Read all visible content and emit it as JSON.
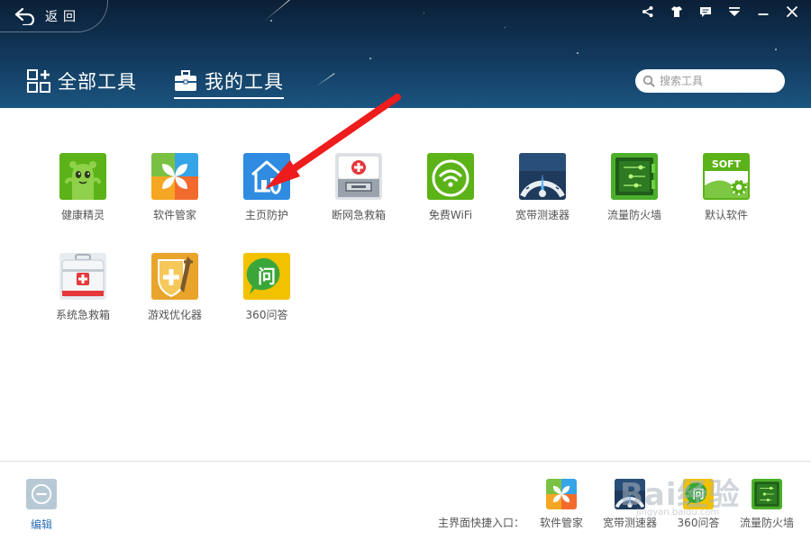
{
  "header": {
    "back_label": "返回",
    "tabs": [
      {
        "label": "全部工具",
        "active": false
      },
      {
        "label": "我的工具",
        "active": true
      }
    ],
    "search_placeholder": "搜索工具",
    "window_controls": [
      "share-icon",
      "skin-icon",
      "feedback-icon",
      "menu-icon",
      "minimize-icon",
      "close-icon"
    ]
  },
  "tools": [
    {
      "label": "健康精灵",
      "icon": "health-sprite-icon",
      "color": "#5bb318"
    },
    {
      "label": "软件管家",
      "icon": "software-manager-icon",
      "color": "#f5a623"
    },
    {
      "label": "主页防护",
      "icon": "homepage-protect-icon",
      "color": "#2f8ce0"
    },
    {
      "label": "断网急救箱",
      "icon": "network-firstaid-icon",
      "color": "#e3e6ea"
    },
    {
      "label": "免费WiFi",
      "icon": "wifi-icon",
      "color": "#5bb318"
    },
    {
      "label": "宽带测速器",
      "icon": "speedometer-icon",
      "color": "#1e3a5c"
    },
    {
      "label": "流量防火墙",
      "icon": "firewall-icon",
      "color": "#4caf2a"
    },
    {
      "label": "默认软件",
      "icon": "default-software-icon",
      "color": "#5bb318"
    },
    {
      "label": "系统急救箱",
      "icon": "system-firstaid-icon",
      "color": "#e8ecef"
    },
    {
      "label": "游戏优化器",
      "icon": "game-optimizer-icon",
      "color": "#e9a42c"
    },
    {
      "label": "360问答",
      "icon": "qa-icon",
      "color": "#f2c200"
    }
  ],
  "footer": {
    "edit_label": "编辑",
    "shortcut_label": "主界面快捷入口：",
    "shortcuts": [
      {
        "label": "软件管家",
        "icon": "software-manager-icon"
      },
      {
        "label": "宽带测速器",
        "icon": "speedometer-icon"
      },
      {
        "label": "360问答",
        "icon": "qa-icon"
      },
      {
        "label": "流量防火墙",
        "icon": "firewall-icon"
      }
    ],
    "watermark": "Bai经验",
    "watermark_sub": "jingyan.baidu.com"
  }
}
